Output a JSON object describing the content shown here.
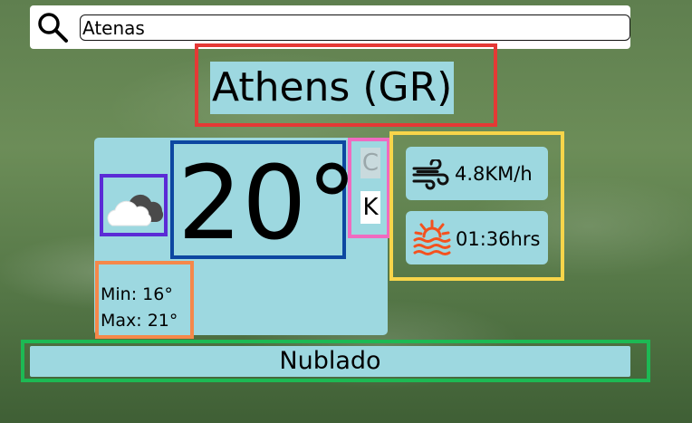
{
  "search": {
    "value": "Atenas",
    "icon": "search-icon"
  },
  "city": {
    "name": "Athens (GR)"
  },
  "weather": {
    "icon": "cloudy-icon",
    "temperature": "20°",
    "units": {
      "celsius": "C",
      "kelvin": "K"
    },
    "min": "Min: 16°",
    "max": "Max: 21°",
    "description": "Nublado"
  },
  "stats": {
    "wind": {
      "icon": "wind-icon",
      "value": "4.8KM/h"
    },
    "daylight": {
      "icon": "sunset-icon",
      "value": "01:36hrs"
    }
  },
  "colors": {
    "card": "#9dd8e0",
    "frame_city": "#e53935",
    "frame_icon": "#5b2bd6",
    "frame_temp": "#0d47a1",
    "frame_units": "#f06bc0",
    "frame_minmax": "#f5884a",
    "frame_stats": "#f7d54a",
    "frame_description": "#1db954",
    "sun_icon": "#f4511e"
  }
}
